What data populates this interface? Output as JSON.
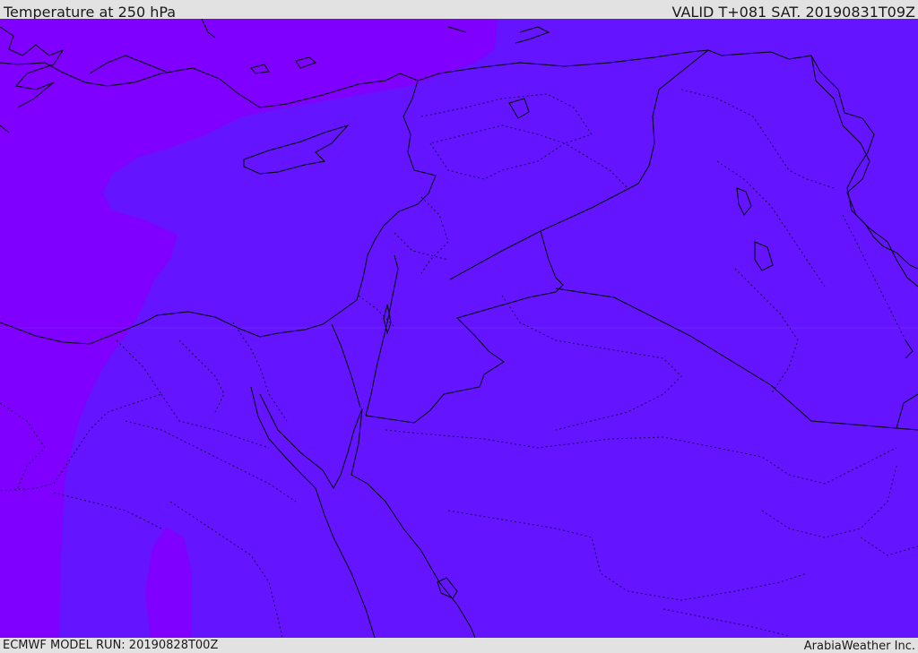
{
  "header": {
    "title": "Temperature at 250 hPa",
    "valid_time": "VALID T+081 SAT. 20190831T09Z"
  },
  "footer": {
    "model_run": "ECMWF MODEL RUN: 20190828T00Z",
    "provider": "ArabiaWeather Inc."
  },
  "map": {
    "fill_colors": {
      "colder": "#7f00ff",
      "warmer": "#6414ff"
    },
    "coastline_color": "#000000",
    "border_color": "#000000"
  }
}
